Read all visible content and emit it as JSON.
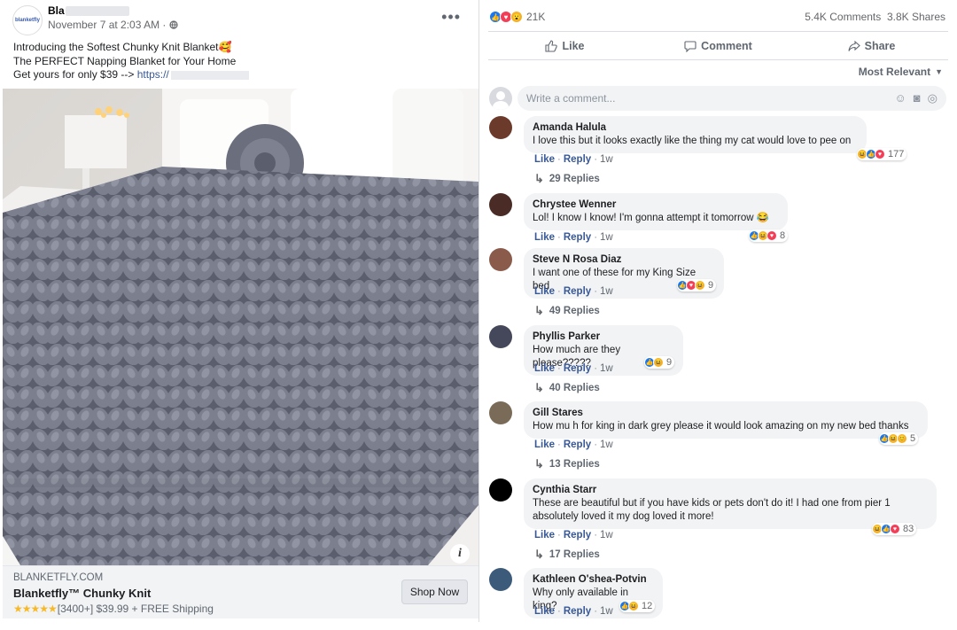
{
  "post": {
    "page_avatar_text": "blanketfly",
    "page_name": "Bla",
    "date": "November 7 at 2:03 AM ·",
    "lines": [
      "Introducing the Softest Chunky Knit Blanket🥰",
      "The PERFECT Napping Blanket for Your Home",
      "Get yours for only $39 -->"
    ],
    "link_text": "https://",
    "image_alt": "Grey chunky knit blanket on a white bed"
  },
  "ad": {
    "domain": "BLANKETFLY.COM",
    "title": "Blanketfly™ Chunky Knit",
    "stars": "★★★★★",
    "subtitle": "[3400+] $39.99 + FREE Shipping",
    "cta": "Shop Now"
  },
  "stats": {
    "reactions_count": "21K",
    "comments": "5.4K Comments",
    "shares": "3.8K Shares"
  },
  "actions": {
    "like": "Like",
    "comment": "Comment",
    "share": "Share"
  },
  "sort_label": "Most Relevant",
  "composer_placeholder": "Write a comment...",
  "comments": [
    {
      "name": "Amanda Halula",
      "text": "I love this but it looks exactly like the thing my cat would love to pee on",
      "reactions": "177",
      "like": "Like",
      "reply": "Reply",
      "time": "1w",
      "replies": "29 Replies",
      "avatar_color": "#6b3a2a"
    },
    {
      "name": "Chrystee Wenner",
      "text": "Lol! I know I know! I'm gonna attempt it tomorrow 😂",
      "reactions": "8",
      "like": "Like",
      "reply": "Reply",
      "time": "1w",
      "replies": "",
      "avatar_color": "#4a2b25"
    },
    {
      "name": "Steve N Rosa Diaz",
      "text": "I want one of these for my King Size bed",
      "reactions": "9",
      "like": "Like",
      "reply": "Reply",
      "time": "1w",
      "replies": "49 Replies",
      "avatar_color": "#8a5a4a"
    },
    {
      "name": "Phyllis Parker",
      "text": "How much are they please?????",
      "reactions": "9",
      "like": "Like",
      "reply": "Reply",
      "time": "1w",
      "replies": "40 Replies",
      "avatar_color": "#45485a"
    },
    {
      "name": "Gill Stares",
      "text": "How mu h for king in dark grey please it would look amazing on my new bed thanks",
      "reactions": "5",
      "like": "Like",
      "reply": "Reply",
      "time": "1w",
      "replies": "13 Replies",
      "avatar_color": "#7a6a58"
    },
    {
      "name": "Cynthia Starr",
      "text": "These are beautiful but if you have kids or pets don't do it! I had one from pier 1 absolutely loved it my dog loved it more!",
      "reactions": "83",
      "like": "Like",
      "reply": "Reply",
      "time": "1w",
      "replies": "17 Replies",
      "avatar_color": "#000000"
    },
    {
      "name": "Kathleen O'shea-Potvin",
      "text": "Why only available in king?",
      "reactions": "12",
      "like": "Like",
      "reply": "Reply",
      "time": "1w",
      "replies": "",
      "avatar_color": "#3c5a7a"
    }
  ],
  "colors": {
    "link": "#385898",
    "like_blue": "#1877f2",
    "love_red": "#f33e58",
    "haha_yellow": "#f7b125"
  }
}
